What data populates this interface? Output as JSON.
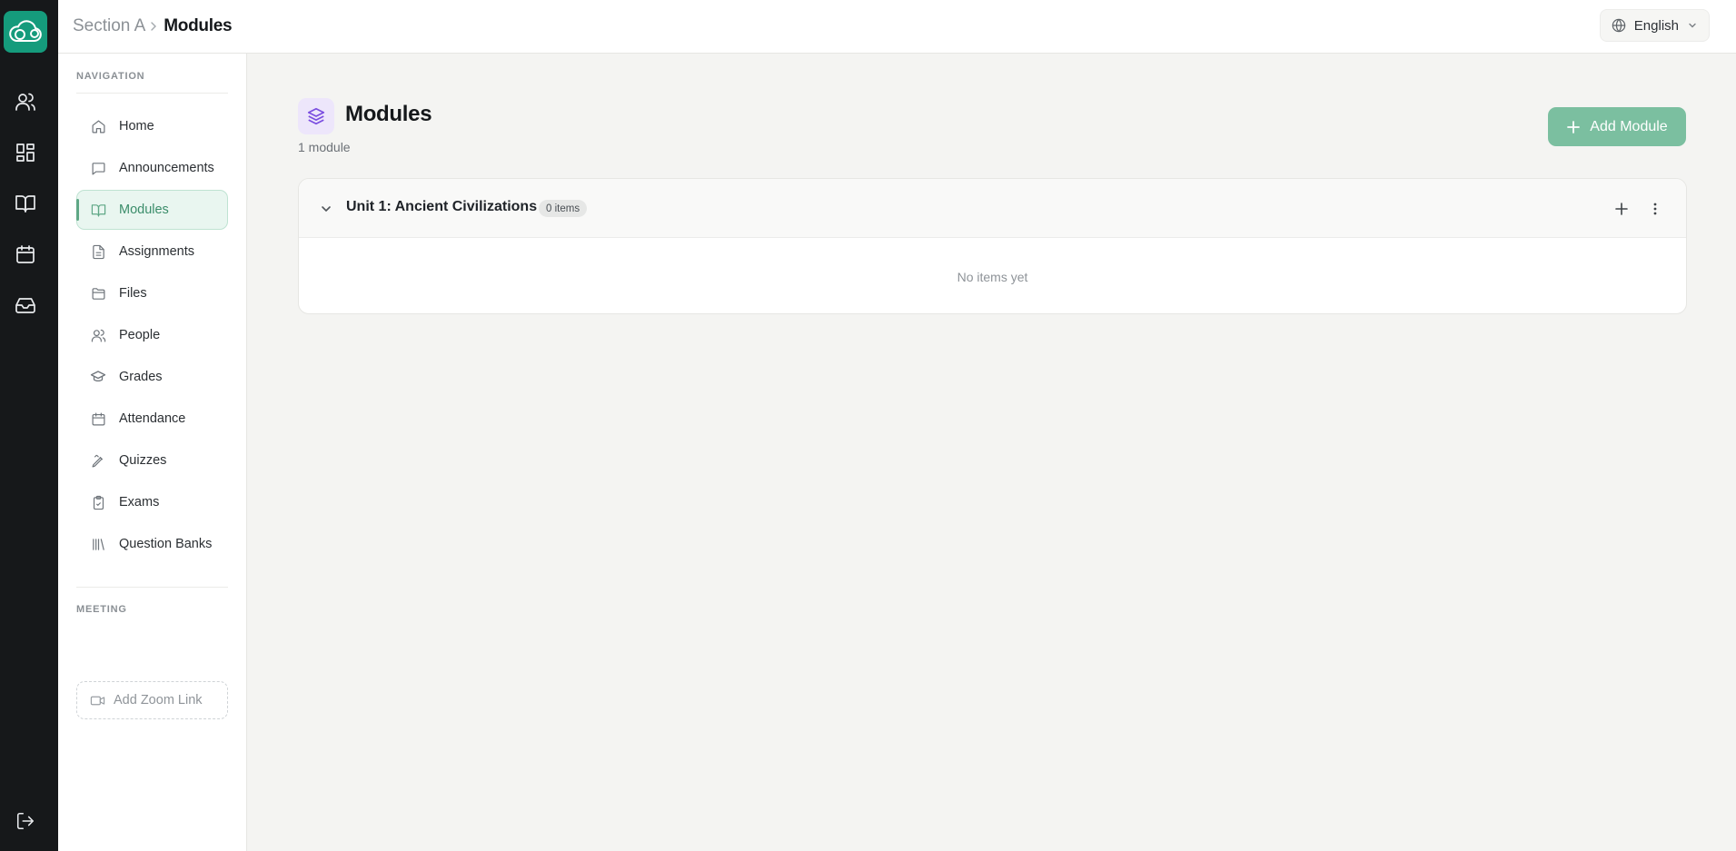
{
  "breadcrumb": {
    "parent": "Section A",
    "current": "Modules"
  },
  "language": {
    "label": "English",
    "icon": "globe-icon"
  },
  "rail": {
    "logo_icon": "cloud-logo-icon",
    "items": [
      "users-icon",
      "dashboard-icon",
      "book-icon",
      "calendar-icon",
      "inbox-icon"
    ],
    "logout_icon": "logout-icon"
  },
  "sidebar": {
    "navigation_label": "NAVIGATION",
    "items": [
      {
        "label": "Home",
        "icon": "home-icon"
      },
      {
        "label": "Announcements",
        "icon": "message-icon"
      },
      {
        "label": "Modules",
        "icon": "book-icon",
        "active": true
      },
      {
        "label": "Assignments",
        "icon": "document-icon"
      },
      {
        "label": "Files",
        "icon": "folder-icon"
      },
      {
        "label": "People",
        "icon": "users-icon"
      },
      {
        "label": "Grades",
        "icon": "graduation-cap-icon"
      },
      {
        "label": "Attendance",
        "icon": "calendar-icon"
      },
      {
        "label": "Quizzes",
        "icon": "pen-icon"
      },
      {
        "label": "Exams",
        "icon": "clipboard-check-icon"
      },
      {
        "label": "Question Banks",
        "icon": "library-icon"
      }
    ],
    "meeting_label": "MEETING",
    "zoom_button": "Add Zoom Link"
  },
  "page": {
    "icon": "layers-icon",
    "title": "Modules",
    "subtitle": "1 module",
    "add_button": "Add Module"
  },
  "modules": [
    {
      "title": "Unit 1: Ancient Civilizations",
      "badge": "0 items",
      "empty_text": "No items yet"
    }
  ],
  "colors": {
    "rail": "#16181a",
    "brand": "#159b7c",
    "accent": "#7bbfa0",
    "active_bg": "#e9f6f0",
    "layers_icon": "#7a4de0"
  }
}
